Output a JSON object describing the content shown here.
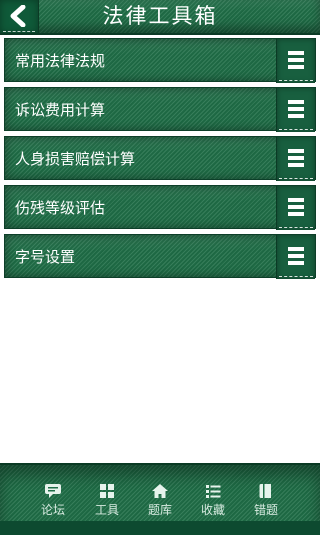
{
  "header": {
    "title": "法律工具箱",
    "back_icon": "chevron-left-icon"
  },
  "menu": {
    "items": [
      {
        "label": "常用法律法规",
        "icon": "menu-lines-icon"
      },
      {
        "label": "诉讼费用计算",
        "icon": "menu-lines-icon"
      },
      {
        "label": "人身损害赔偿计算",
        "icon": "menu-lines-icon"
      },
      {
        "label": "伤残等级评估",
        "icon": "menu-lines-icon"
      },
      {
        "label": "字号设置",
        "icon": "menu-lines-icon"
      }
    ]
  },
  "tabs": [
    {
      "label": "论坛",
      "icon": "chat-bubble-icon"
    },
    {
      "label": "工具",
      "icon": "grid-icon"
    },
    {
      "label": "题库",
      "icon": "home-icon"
    },
    {
      "label": "收藏",
      "icon": "list-icon"
    },
    {
      "label": "错题",
      "icon": "book-icon"
    }
  ],
  "colors": {
    "primary_green": "#1f6e47",
    "dark_green": "#0b3a25",
    "text_white": "#ffffff"
  }
}
